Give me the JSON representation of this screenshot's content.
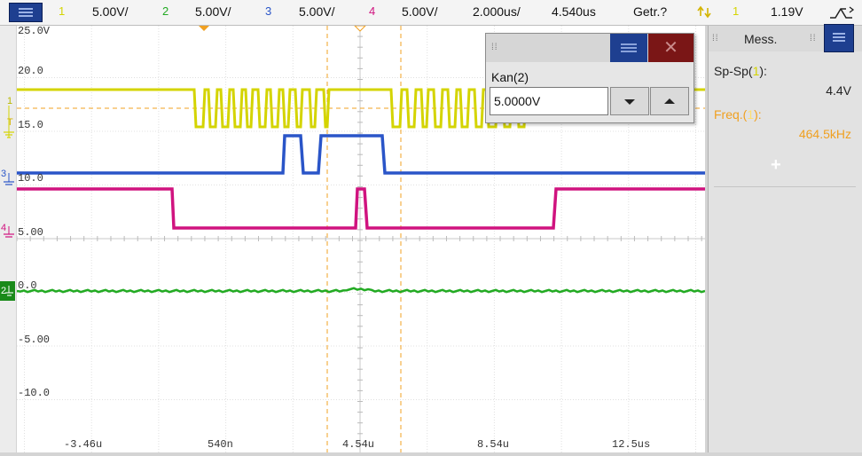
{
  "colors": {
    "ch1": "#d4d400",
    "ch2": "#22aa22",
    "ch3": "#2a55c8",
    "ch4": "#d0137f",
    "cursor": "#f0a020",
    "accent_blue": "#1e3f90",
    "freq_orange": "#f0a020"
  },
  "topbar": {
    "menu_icon": "menu-icon",
    "ch1_num": "1",
    "ch1_scale": "5.00V/",
    "ch2_num": "2",
    "ch2_scale": "5.00V/",
    "ch3_num": "3",
    "ch3_scale": "5.00V/",
    "ch4_num": "4",
    "ch4_scale": "5.00V/",
    "timebase": "2.000us/",
    "delay": "4.540us",
    "trigger_mode": "Getr.?",
    "trigger_icon": "trigger-edge-icon",
    "trigger_channel": "1",
    "trigger_level": "1.19V",
    "slope_icon": "slope-either-icon"
  },
  "y_labels": [
    "25.0V",
    "20.0",
    "15.0",
    "10.0",
    "5.00",
    "0.0",
    "-5.00",
    "-10.0"
  ],
  "x_labels": [
    "-3.46u",
    "540n",
    "4.54u",
    "8.54u",
    "12.5us"
  ],
  "markers": {
    "ch1_marker": "1",
    "ch1_level_marker": "T",
    "ch3_marker": "3",
    "ch4_marker": "4",
    "ch2_marker": "2"
  },
  "panel": {
    "title": "Mess.",
    "meas1_label_a": "Sp-Sp(",
    "meas1_label_ch": "1",
    "meas1_label_b": "):",
    "meas1_value": "4.4V",
    "meas2_label_a": "Freq.(",
    "meas2_label_ch": "1",
    "meas2_label_b": "):",
    "meas2_value": "464.5kHz",
    "add_label": "+"
  },
  "dialog": {
    "label": "Kan(2)",
    "value": "5.0000V",
    "close_label": "✕"
  }
}
